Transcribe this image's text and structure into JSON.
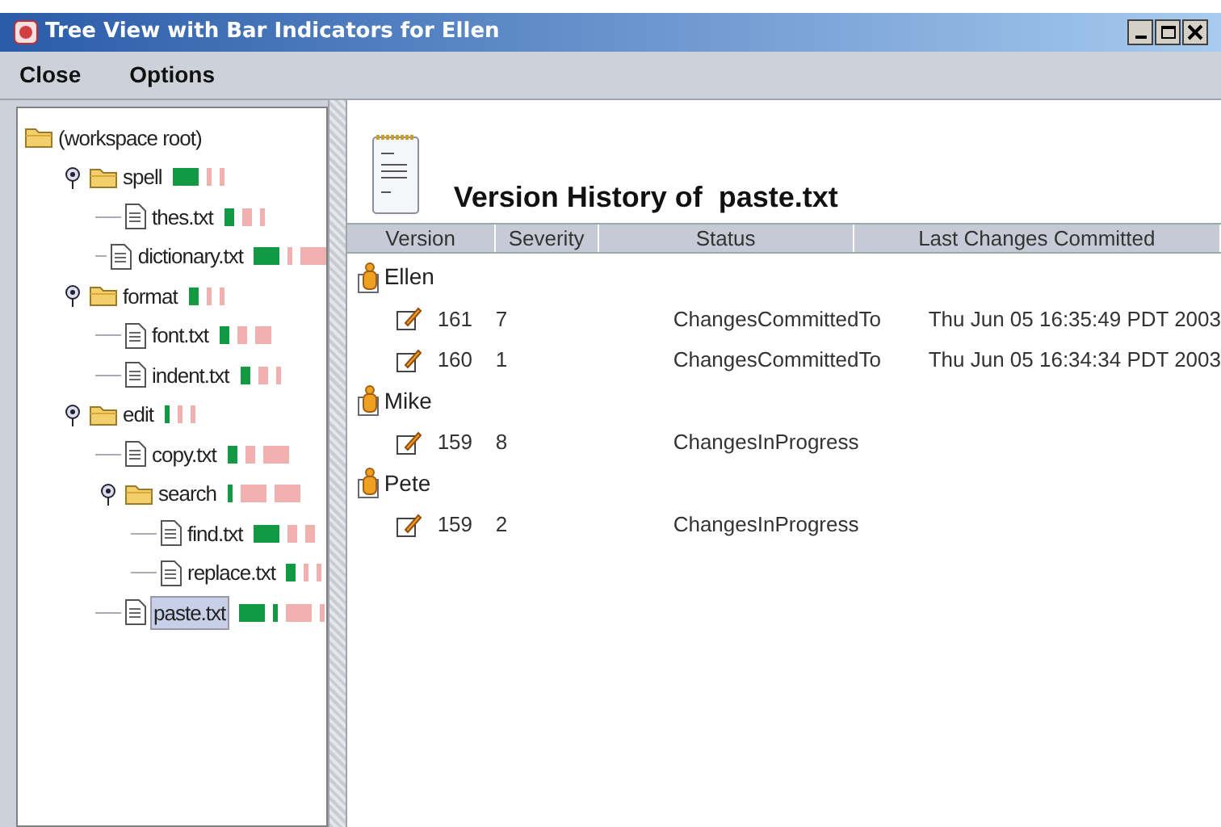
{
  "window": {
    "title": "Tree View with Bar Indicators for Ellen"
  },
  "menu": [
    "Close",
    "Options"
  ],
  "tree": {
    "label": "(workspace root)",
    "kind": "root",
    "children": [
      {
        "label": "spell",
        "kind": "folder",
        "expanded": true,
        "bars": [
          {
            "kind": "wide",
            "color": "#119944"
          },
          {
            "kind": "thin",
            "color": "#f0b0b0"
          },
          {
            "kind": "thin",
            "color": "#f0b0b0"
          }
        ],
        "children": [
          {
            "label": "thes.txt",
            "kind": "file",
            "selected": false,
            "bars": [
              {
                "kind": "narrow",
                "color": "#119944"
              },
              {
                "kind": "narrow",
                "color": "#f0b0b0"
              },
              {
                "kind": "thin",
                "color": "#f0b0b0"
              }
            ]
          },
          {
            "label": "dictionary.txt",
            "kind": "file",
            "selected": false,
            "bars": [
              {
                "kind": "wide",
                "color": "#119944"
              },
              {
                "kind": "thin",
                "color": "#f0b0b0"
              },
              {
                "kind": "wide",
                "color": "#f0b0b0"
              }
            ]
          }
        ]
      },
      {
        "label": "format",
        "kind": "folder",
        "expanded": true,
        "bars": [
          {
            "kind": "narrow",
            "color": "#119944"
          },
          {
            "kind": "thin",
            "color": "#f0b0b0"
          },
          {
            "kind": "thin",
            "color": "#f0b0b0"
          }
        ],
        "children": [
          {
            "label": "font.txt",
            "kind": "file",
            "selected": false,
            "bars": [
              {
                "kind": "narrow",
                "color": "#119944"
              },
              {
                "kind": "narrow",
                "color": "#f0b0b0"
              },
              {
                "kind": "medium",
                "color": "#f0b0b0"
              }
            ]
          },
          {
            "label": "indent.txt",
            "kind": "file",
            "selected": false,
            "bars": [
              {
                "kind": "narrow",
                "color": "#119944"
              },
              {
                "kind": "narrow",
                "color": "#f0b0b0"
              },
              {
                "kind": "thin",
                "color": "#f0b0b0"
              }
            ]
          }
        ]
      },
      {
        "label": "edit",
        "kind": "folder",
        "expanded": true,
        "bars": [
          {
            "kind": "thin",
            "color": "#119944"
          },
          {
            "kind": "thin",
            "color": "#f0b0b0"
          },
          {
            "kind": "thin",
            "color": "#f0b0b0"
          }
        ],
        "children": [
          {
            "label": "copy.txt",
            "kind": "file",
            "selected": false,
            "bars": [
              {
                "kind": "narrow",
                "color": "#119944"
              },
              {
                "kind": "narrow",
                "color": "#f0b0b0"
              },
              {
                "kind": "wide",
                "color": "#f0b0b0"
              }
            ]
          },
          {
            "label": "search",
            "kind": "folder",
            "expanded": true,
            "bars": [
              {
                "kind": "thin",
                "color": "#119944"
              },
              {
                "kind": "wide",
                "color": "#f0b0b0"
              },
              {
                "kind": "wide",
                "color": "#f0b0b0"
              }
            ],
            "children": [
              {
                "label": "find.txt",
                "kind": "file",
                "selected": false,
                "bars": [
                  {
                    "kind": "wide",
                    "color": "#119944"
                  },
                  {
                    "kind": "narrow",
                    "color": "#f0b0b0"
                  },
                  {
                    "kind": "narrow",
                    "color": "#f0b0b0"
                  }
                ]
              },
              {
                "label": "replace.txt",
                "kind": "file",
                "selected": false,
                "bars": [
                  {
                    "kind": "narrow",
                    "color": "#119944"
                  },
                  {
                    "kind": "thin",
                    "color": "#f0b0b0"
                  },
                  {
                    "kind": "thin",
                    "color": "#f0b0b0"
                  }
                ]
              }
            ]
          },
          {
            "label": "paste.txt",
            "kind": "file",
            "selected": true,
            "bars": [
              {
                "kind": "wide",
                "color": "#119944"
              },
              {
                "kind": "thin",
                "color": "#119944"
              },
              {
                "kind": "wide",
                "color": "#f0b0b0"
              },
              {
                "kind": "thin",
                "color": "#f0b0b0"
              }
            ]
          }
        ]
      }
    ]
  },
  "history": {
    "title": "Version History of  paste.txt",
    "columns": [
      "Version",
      "Severity",
      "Status",
      "Last Changes Committed"
    ],
    "groups": [
      {
        "user": "Ellen",
        "rows": [
          [
            "161",
            "7",
            "ChangesCommittedTo",
            "Thu Jun 05 16:35:49 PDT 2003"
          ],
          [
            "160",
            "1",
            "ChangesCommittedTo",
            "Thu Jun 05 16:34:34 PDT 2003"
          ]
        ]
      },
      {
        "user": "Mike",
        "rows": [
          [
            "159",
            "8",
            "ChangesInProgress"
          ]
        ]
      },
      {
        "user": "Pete",
        "rows": [
          [
            "159",
            "2",
            "ChangesInProgress"
          ]
        ]
      }
    ]
  }
}
